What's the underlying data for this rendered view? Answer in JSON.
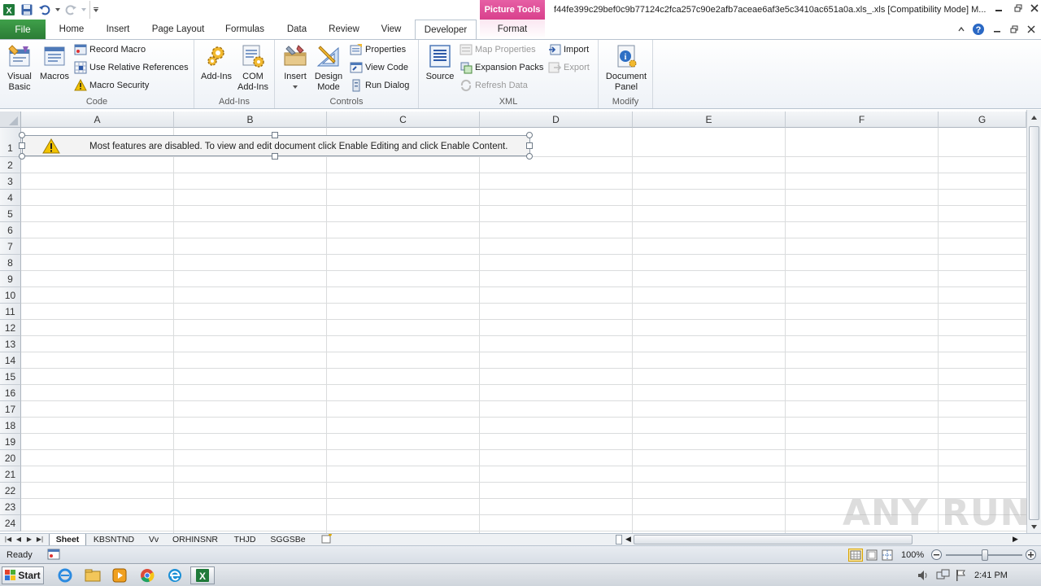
{
  "window": {
    "title": "f44fe399c29bef0c9b77124c2fca257c90e2afb7aceae6af3e5c3410ac651a0a.xls_.xls  [Compatibility Mode] M...",
    "context_tab": "Picture Tools"
  },
  "tabs": {
    "file": "File",
    "items": [
      "Home",
      "Insert",
      "Page Layout",
      "Formulas",
      "Data",
      "Review",
      "View",
      "Developer",
      "Format"
    ],
    "active": "Developer"
  },
  "ribbon": {
    "code": {
      "label": "Code",
      "visual_basic": "Visual Basic",
      "visual_basic_l1": "Visual",
      "visual_basic_l2": "Basic",
      "macros": "Macros",
      "record_macro": "Record Macro",
      "relative_refs": "Use Relative References",
      "macro_security": "Macro Security"
    },
    "addins": {
      "label": "Add-Ins",
      "addins": "Add-Ins",
      "com_l1": "COM",
      "com_l2": "Add-Ins"
    },
    "controls": {
      "label": "Controls",
      "insert": "Insert",
      "design_l1": "Design",
      "design_l2": "Mode",
      "properties": "Properties",
      "view_code": "View Code",
      "run_dialog": "Run Dialog"
    },
    "xml": {
      "label": "XML",
      "source": "Source",
      "map_properties": "Map Properties",
      "expansion_packs": "Expansion Packs",
      "refresh_data": "Refresh Data",
      "import": "Import",
      "export": "Export"
    },
    "modify": {
      "label": "Modify",
      "doc_l1": "Document",
      "doc_l2": "Panel"
    }
  },
  "sheet": {
    "columns": [
      "A",
      "B",
      "C",
      "D",
      "E",
      "F",
      "G"
    ],
    "rows": [
      "1",
      "2",
      "3",
      "4",
      "5",
      "6",
      "7",
      "8",
      "9",
      "10",
      "11",
      "12",
      "13",
      "14",
      "15",
      "16",
      "17",
      "18",
      "19",
      "20",
      "21",
      "22",
      "23",
      "24"
    ],
    "warning_text": "Most features are disabled. To view and edit document click Enable Editing and click Enable Content."
  },
  "sheet_tabs": [
    "Sheet",
    "KBSNTND",
    "Vv",
    "ORHINSNR",
    "THJD",
    "SGGSBe"
  ],
  "status": {
    "ready": "Ready",
    "zoom": "100%"
  },
  "taskbar": {
    "start": "Start",
    "clock": "2:41 PM"
  },
  "watermark": "ANY RUN",
  "colors": {
    "file_tab": "#2b7c35",
    "picture_tools": "#d9408c",
    "ribbon_bg": "#eef2f7"
  }
}
